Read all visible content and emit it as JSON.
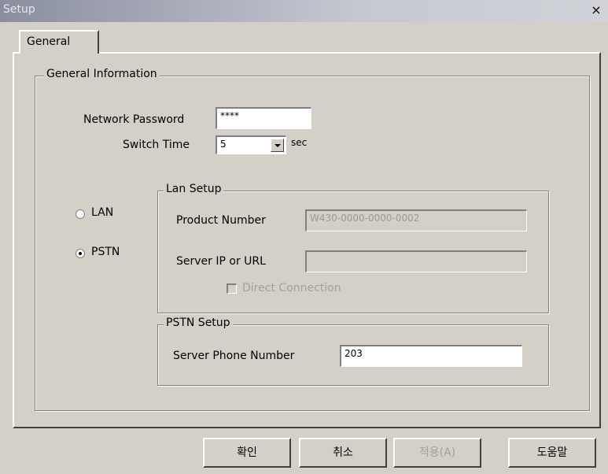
{
  "window": {
    "title": "Setup",
    "close_glyph": "×"
  },
  "tabs": [
    {
      "label": "General"
    }
  ],
  "general_info": {
    "legend": "General Information",
    "network_password_label": "Network Password",
    "network_password_value": "****",
    "switch_time_label": "Switch Time",
    "switch_time_value": "5",
    "switch_time_unit": "sec"
  },
  "connection": {
    "lan_label": "LAN",
    "pstn_label": "PSTN",
    "selected": "PSTN"
  },
  "lan_setup": {
    "legend": "Lan Setup",
    "product_number_label": "Product Number",
    "product_number_value": "W430-0000-0000-0002",
    "server_ip_label": "Server IP or URL",
    "server_ip_value": "",
    "direct_connection_label": "Direct Connection",
    "direct_connection_checked": false
  },
  "pstn_setup": {
    "legend": "PSTN Setup",
    "server_phone_label": "Server Phone Number",
    "server_phone_value": "203"
  },
  "buttons": {
    "ok": "확인",
    "cancel": "취소",
    "apply": "적용(A)",
    "help": "도움말"
  }
}
